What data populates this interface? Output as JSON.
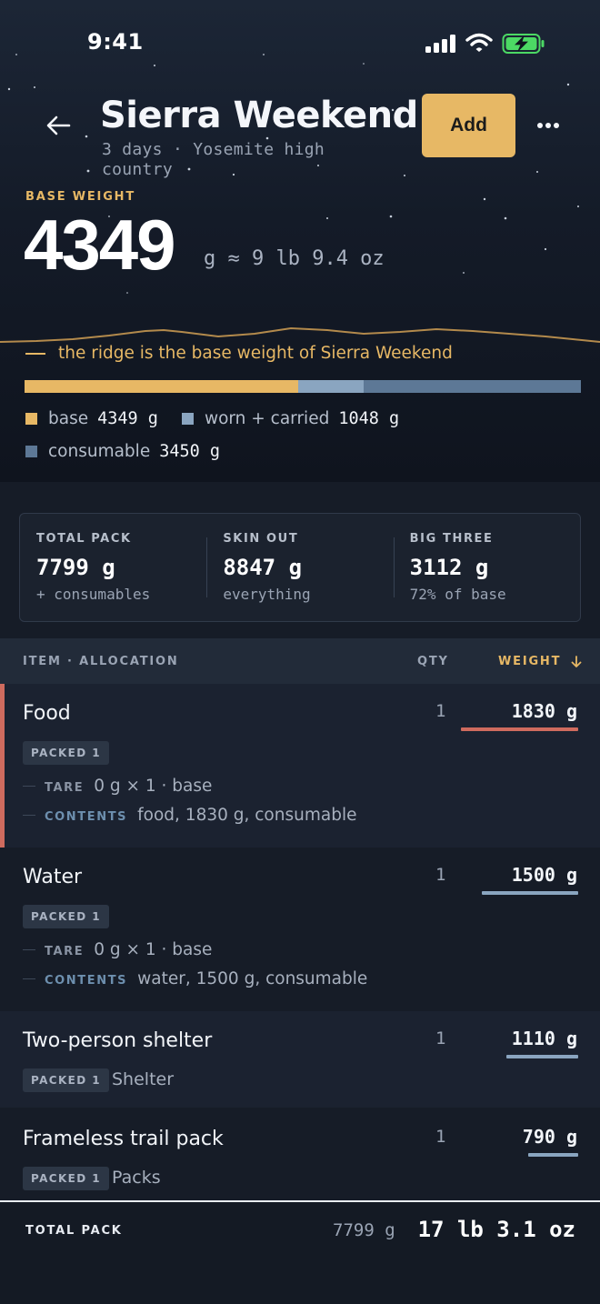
{
  "status_bar": {
    "time": "9:41"
  },
  "header": {
    "title": "Sierra Weekend",
    "subtitle": "3 days · Yosemite high country",
    "add_label": "Add",
    "more_label": "•••"
  },
  "base_weight": {
    "label": "BASE WEIGHT",
    "grams": "4349",
    "conversion": "g ≈ 9 lb 9.4 oz",
    "ridge_caption": "the ridge is the base weight of Sierra Weekend"
  },
  "allocation": {
    "segments": [
      {
        "name": "base",
        "grams": 4349,
        "color": "#e7b865"
      },
      {
        "name": "worn",
        "grams": 1048,
        "color": "#8aa5c0"
      },
      {
        "name": "consumable",
        "grams": 3450,
        "color": "#5d7896"
      }
    ],
    "legend": {
      "base_label": "base",
      "base_value": "4349 g",
      "worn_label": "worn + carried",
      "worn_value": "1048 g",
      "consumable_label": "consumable",
      "consumable_value": "3450 g"
    }
  },
  "stats": {
    "total": {
      "label": "TOTAL PACK",
      "value": "7799 g",
      "note": "+ consumables"
    },
    "skin": {
      "label": "SKIN OUT",
      "value": "8847 g",
      "note": "everything"
    },
    "big3": {
      "label": "BIG THREE",
      "value": "3112 g",
      "note": "72% of base"
    }
  },
  "table": {
    "col_item": "ITEM · ALLOCATION",
    "col_qty": "QTY",
    "col_weight": "WEIGHT",
    "rows": [
      {
        "name": "Food",
        "qty": "1",
        "weight": "1830 g",
        "fraction": 1.0,
        "color": "#cf6b5e",
        "badge": "PACKED 1",
        "tare_key": "TARE",
        "tare": "0 g × 1 · base",
        "contents_key": "CONTENTS",
        "contents": "food, 1830 g, consumable"
      },
      {
        "name": "Water",
        "qty": "1",
        "weight": "1500 g",
        "fraction": 0.82,
        "color": "#8aa5c0",
        "badge": "PACKED 1",
        "tare_key": "TARE",
        "tare": "0 g × 1 · base",
        "contents_key": "CONTENTS",
        "contents": "water, 1500 g, consumable"
      },
      {
        "name": "Two-person shelter",
        "qty": "1",
        "weight": "1110 g",
        "fraction": 0.61,
        "color": "#8aa5c0",
        "badge": "PACKED 1",
        "category": "Shelter"
      },
      {
        "name": "Frameless trail pack",
        "qty": "1",
        "weight": "790 g",
        "fraction": 0.43,
        "color": "#8aa5c0",
        "badge": "PACKED 1",
        "category": "Packs"
      }
    ]
  },
  "footer": {
    "label": "TOTAL PACK",
    "grams": "7799 g",
    "imperial": "17 lb 3.1 oz"
  }
}
